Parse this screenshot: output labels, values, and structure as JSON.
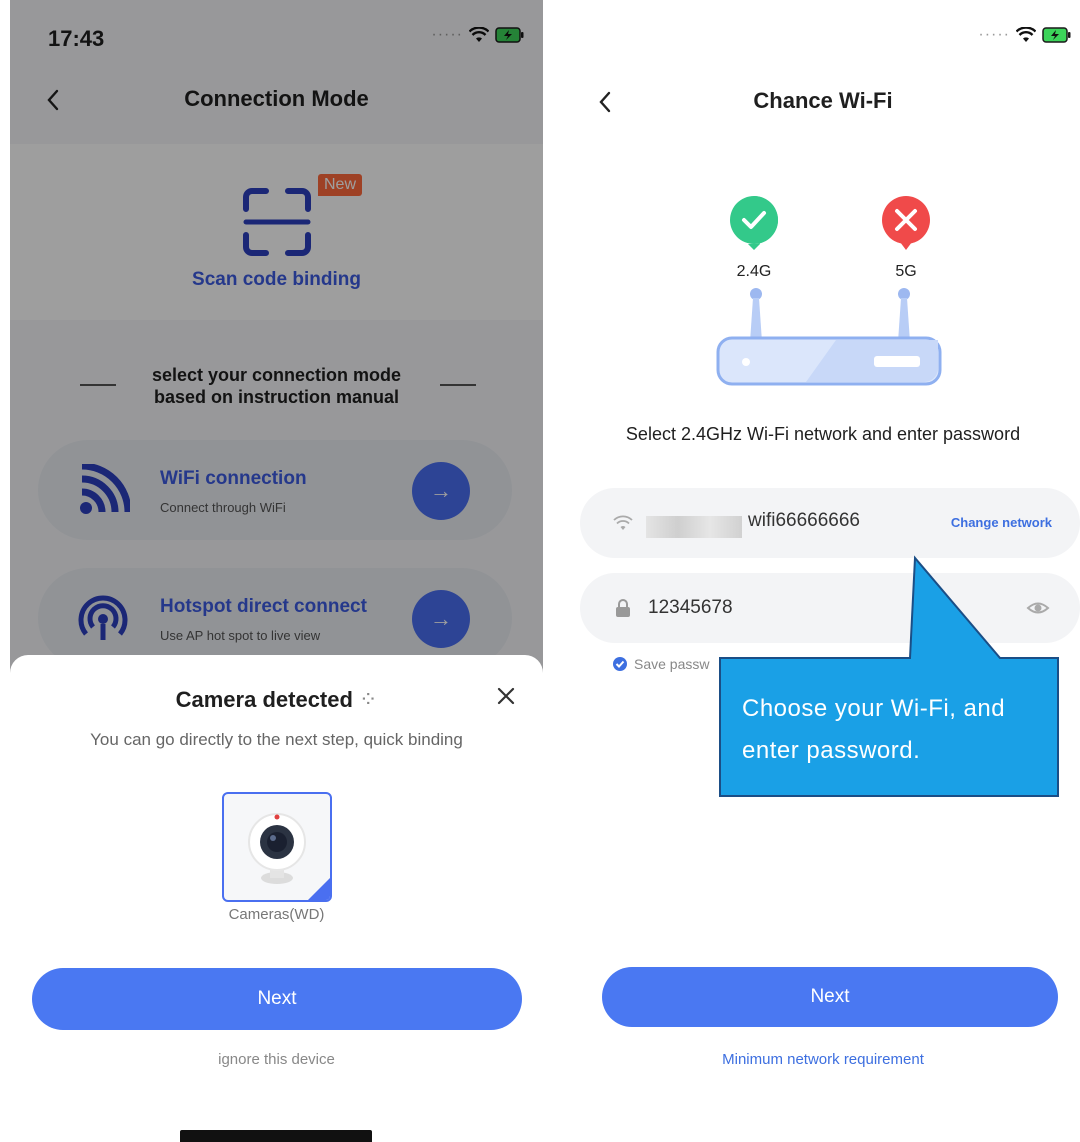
{
  "left": {
    "status": {
      "time": "17:43"
    },
    "nav": {
      "title": "Connection Mode"
    },
    "scan": {
      "badge": "New",
      "label": "Scan code binding"
    },
    "select_title": [
      "select your connection mode",
      "based on instruction manual"
    ],
    "modes": [
      {
        "title": "WiFi connection",
        "subtitle": "Connect through WiFi",
        "icon": "wifi-signal-icon"
      },
      {
        "title": "Hotspot direct connect",
        "subtitle": "Use AP hot spot to live view",
        "icon": "hotspot-icon"
      }
    ],
    "sheet": {
      "title": "Camera detected",
      "subtitle": "You can go directly to the next step, quick binding",
      "device_label": "Cameras(WD)",
      "next": "Next",
      "ignore": "ignore this device"
    }
  },
  "right": {
    "nav": {
      "title": "Chance Wi-Fi"
    },
    "bands": {
      "band_24": "2.4G",
      "band_5": "5G"
    },
    "instruction": "Select 2.4GHz Wi-Fi network and enter password",
    "wifi": {
      "name": "wifi66666666",
      "change": "Change network"
    },
    "password": {
      "value": "12345678"
    },
    "save_password": "Save passw",
    "next": "Next",
    "min_req": "Minimum network requirement"
  },
  "callout": {
    "lines": [
      "Choose your Wi-Fi, and",
      "enter password."
    ]
  },
  "colors": {
    "accent": "#4a78f2",
    "link": "#3d6fe0",
    "ok": "#33c98a",
    "error": "#f04a4a",
    "callout": "#1aa0e6",
    "badge": "#ff6a3d"
  }
}
